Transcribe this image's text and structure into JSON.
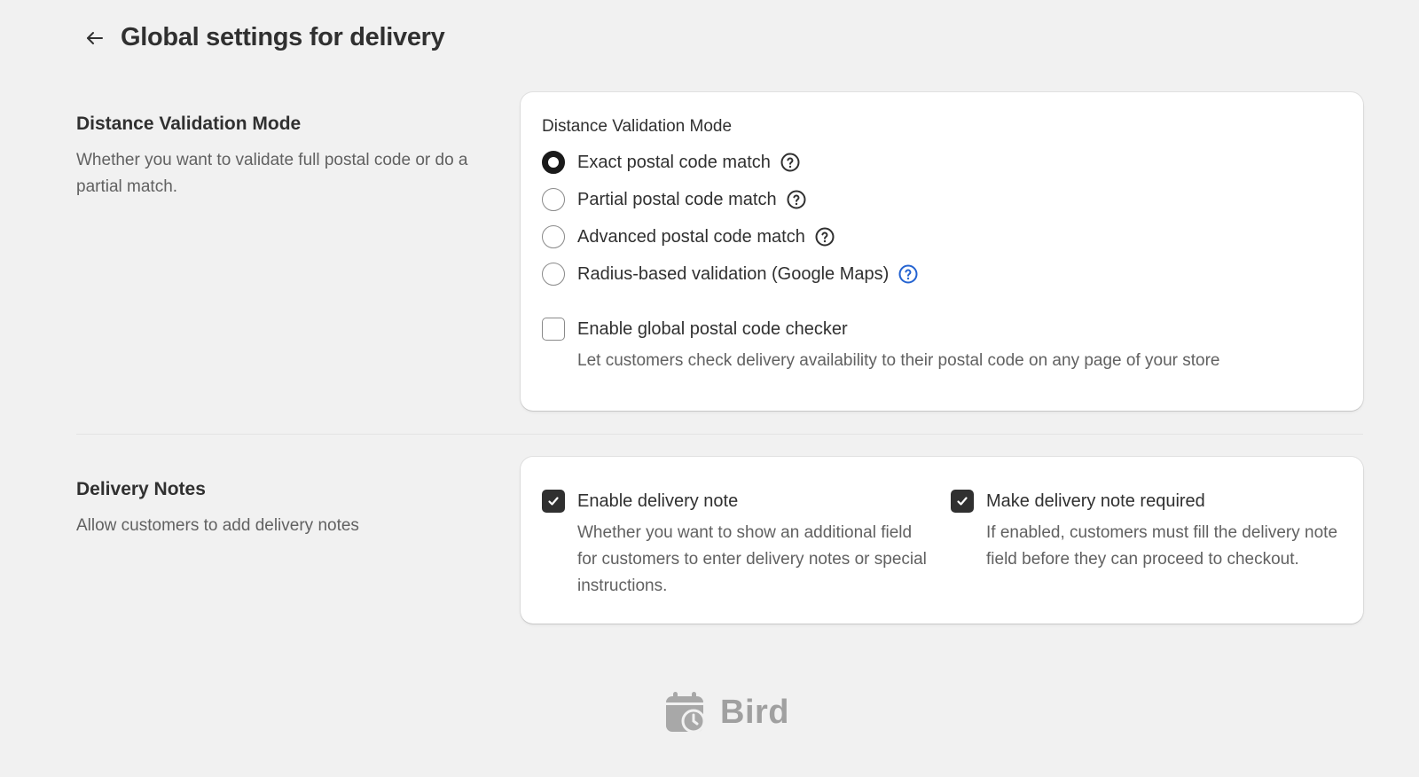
{
  "header": {
    "title": "Global settings for delivery"
  },
  "distance_section": {
    "title": "Distance Validation Mode",
    "description": "Whether you want to validate full postal code or do a partial match.",
    "card_label": "Distance Validation Mode",
    "options": [
      {
        "label": "Exact postal code match",
        "selected": true,
        "help_color": "#303030"
      },
      {
        "label": "Partial postal code match",
        "selected": false,
        "help_color": "#303030"
      },
      {
        "label": "Advanced postal code match",
        "selected": false,
        "help_color": "#303030"
      },
      {
        "label": "Radius-based validation (Google Maps)",
        "selected": false,
        "help_color": "#2463d1"
      }
    ],
    "global_checker": {
      "label": "Enable global postal code checker",
      "help": "Let customers check delivery availability to their postal code on any page of your store",
      "checked": false
    }
  },
  "notes_section": {
    "title": "Delivery Notes",
    "description": "Allow customers to add delivery notes",
    "enable_note": {
      "label": "Enable delivery note",
      "help": "Whether you want to show an additional field for customers to enter delivery notes or special instructions.",
      "checked": true
    },
    "require_note": {
      "label": "Make delivery note required",
      "help": "If enabled, customers must fill the delivery note field before they can proceed to checkout.",
      "checked": true
    }
  },
  "footer": {
    "brand": "Bird"
  },
  "icons": {
    "back": "arrow-left-icon",
    "help": "question-circle-icon",
    "check": "checkmark-icon",
    "logo": "calendar-clock-icon"
  }
}
